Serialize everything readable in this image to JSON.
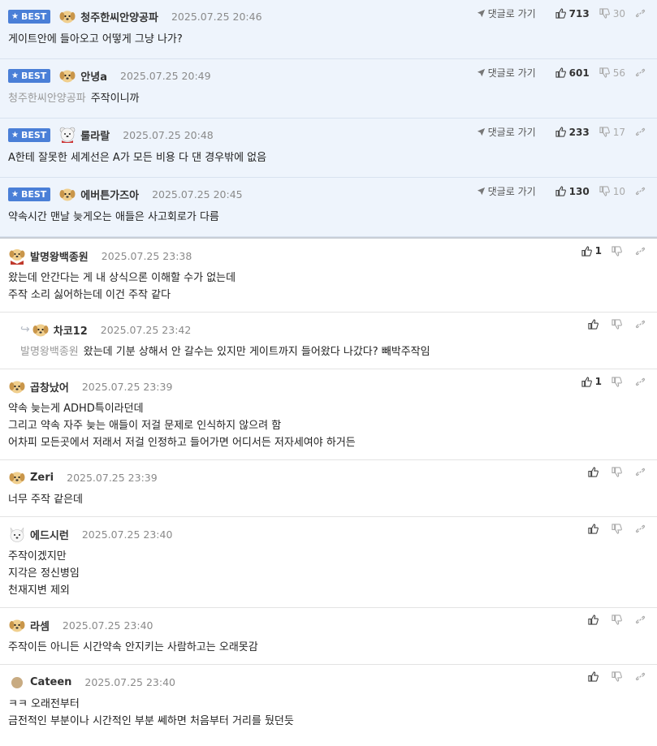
{
  "labels": {
    "best": "BEST",
    "goto": "댓글로 가기"
  },
  "best_comments": [
    {
      "nick": "청주한씨안양공파",
      "date": "2025.07.25 20:46",
      "up": "713",
      "down": "30",
      "avatar": "dog-avatar",
      "text": "게이트안에 들아오고 어떻게 그냥 나가?"
    },
    {
      "nick": "안녕a",
      "date": "2025.07.25 20:49",
      "up": "601",
      "down": "56",
      "avatar": "dog-avatar",
      "mention": "청주한씨안양공파",
      "text": "주작이니까"
    },
    {
      "nick": "룰라랄",
      "date": "2025.07.25 20:48",
      "up": "233",
      "down": "17",
      "avatar": "bear-avatar",
      "text": "A한테 잘못한 세계선은 A가 모든 비용 다 댄 경우밖에 없음"
    },
    {
      "nick": "에버튼가즈아",
      "date": "2025.07.25 20:45",
      "up": "130",
      "down": "10",
      "avatar": "dog-avatar",
      "text": "약속시간 맨날 늦게오는 애들은 사고회로가 다름"
    }
  ],
  "comments": [
    {
      "nick": "발명왕백종원",
      "date": "2025.07.25 23:38",
      "up": "1",
      "avatar": "chef-dog-avatar",
      "lines": [
        "왔는데 안간다는 게 내 상식으론 이해할 수가 없는데",
        "주작 소리 싫어하는데 이건 주작 같다"
      ]
    },
    {
      "nick": "차코12",
      "date": "2025.07.25 23:42",
      "up": "",
      "avatar": "dog-avatar",
      "reply": true,
      "mention": "발명왕백종원",
      "lines": [
        "왔는데 기분 상해서 안 갈수는 있지만 게이트까지 들어왔다 나갔다? 빼박주작임"
      ]
    },
    {
      "nick": "곱창났어",
      "date": "2025.07.25 23:39",
      "up": "1",
      "avatar": "dog-avatar",
      "lines": [
        "약속 늦는게 ADHD특이라던데",
        "그리고 약속 자주 늦는 애들이 저걸 문제로 인식하지 않으려 함",
        "어차피 모든곳에서 저래서 저걸 인정하고 들어가면 어디서든 저자세여야 하거든"
      ]
    },
    {
      "nick": "Zeri",
      "date": "2025.07.25 23:39",
      "up": "",
      "avatar": "dog-avatar",
      "lines": [
        "너무 주작 같은데"
      ]
    },
    {
      "nick": "에드시런",
      "date": "2025.07.25 23:40",
      "up": "",
      "avatar": "white-dog-avatar",
      "lines": [
        "주작이겠지만",
        "지각은 정신병임",
        "천재지변 제외"
      ]
    },
    {
      "nick": "라셈",
      "date": "2025.07.25 23:40",
      "up": "",
      "avatar": "dog-avatar",
      "lines": [
        "주작이든 아니든 시간약속 안지키는 사람하고는 오래못감"
      ]
    },
    {
      "nick": "Cateen",
      "date": "2025.07.25 23:40",
      "up": "",
      "avatar": "circle-avatar",
      "lines": [
        "ㅋㅋ 오래전부터",
        "금전적인 부분이나 시간적인 부분 쎄하면 처음부터 거리를 뒀던듯"
      ]
    }
  ]
}
